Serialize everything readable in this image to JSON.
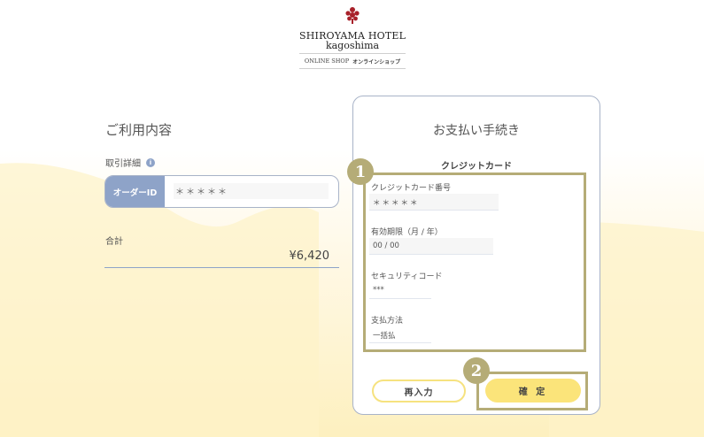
{
  "header": {
    "logo_title": "SHIROYAMA HOTEL",
    "logo_subtitle": "kagoshima",
    "shop_en": "ONLINE SHOP",
    "shop_jp": "オンラインショップ"
  },
  "usage": {
    "title": "ご利用内容",
    "detail_label": "取引詳細",
    "info_icon": "i",
    "order_tag": "オーダーID",
    "order_value": "＊＊＊＊＊",
    "total_label": "合計",
    "total_value": "¥6,420"
  },
  "payment": {
    "title": "お支払い手続き",
    "subtitle": "クレジットカード",
    "fields": [
      {
        "label": "クレジットカード番号",
        "value": "＊＊＊＊＊"
      },
      {
        "label": "有効期限（月 / 年）",
        "value": "00 / 00"
      },
      {
        "label": "セキュリティコード",
        "value": "***"
      },
      {
        "label": "支払方法",
        "value": "一括払"
      }
    ],
    "reset_label": "再入力",
    "confirm_label": "確 定"
  },
  "annotations": {
    "badge1": "1",
    "badge2": "2",
    "color": "#b5ac77"
  },
  "colors": {
    "accent_blue": "#8ea3c8",
    "button_yellow": "#fbe47a",
    "logo_red": "#a8212a"
  }
}
